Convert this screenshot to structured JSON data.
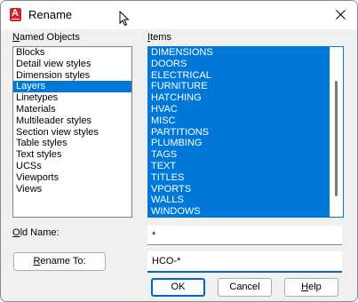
{
  "window": {
    "title": "Rename",
    "app_icon_letter": "A"
  },
  "named_objects": {
    "label": "Named Objects",
    "items": [
      "Blocks",
      "Detail view styles",
      "Dimension styles",
      "Layers",
      "Linetypes",
      "Materials",
      "Multileader styles",
      "Section view styles",
      "Table styles",
      "Text styles",
      "UCSs",
      "Viewports",
      "Views"
    ],
    "selected": "Layers"
  },
  "items_list": {
    "label": "Items",
    "items": [
      "DIMENSIONS",
      "DOORS",
      "ELECTRICAL",
      "FURNITURE",
      "HATCHING",
      "HVAC",
      "MISC",
      "PARTITIONS",
      "PLUMBING",
      "TAGS",
      "TEXT",
      "TITLES",
      "VPORTS",
      "WALLS",
      "WINDOWS"
    ]
  },
  "old_name": {
    "label": "Old Name:",
    "value": "*"
  },
  "rename_to": {
    "button_label": "Rename To:",
    "value": "HCO-*"
  },
  "buttons": {
    "ok": "OK",
    "cancel": "Cancel",
    "help": "Help"
  },
  "colors": {
    "selection": "#0078d7",
    "focus": "#0067c0",
    "app_icon": "#d6202a"
  }
}
